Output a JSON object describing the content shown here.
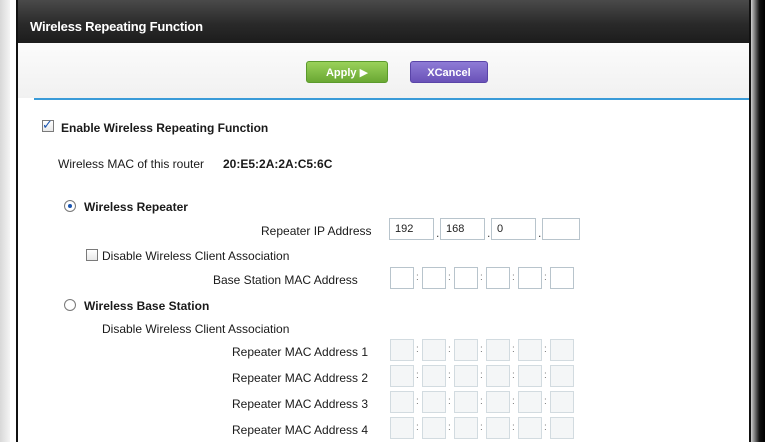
{
  "header": {
    "title": "Wireless Repeating Function"
  },
  "toolbar": {
    "apply_label": "Apply ▶",
    "cancel_label": "XCancel"
  },
  "enable": {
    "label": "Enable Wireless Repeating Function",
    "checked": true
  },
  "router_mac": {
    "label": "Wireless MAC of this router",
    "value": "20:E5:2A:2A:C5:6C"
  },
  "repeater": {
    "label": "Wireless Repeater",
    "selected": true,
    "ip_label": "Repeater IP Address",
    "ip": [
      "192",
      "168",
      "0",
      ""
    ],
    "disable_assoc_label": "Disable Wireless Client Association",
    "base_mac_label": "Base Station MAC Address"
  },
  "base_station": {
    "label": "Wireless Base Station",
    "selected": false,
    "disable_assoc_label": "Disable Wireless Client Association",
    "mac_labels": [
      "Repeater MAC Address 1",
      "Repeater MAC Address 2",
      "Repeater MAC Address 3",
      "Repeater MAC Address 4"
    ]
  },
  "colors": {
    "apply": "#7ab845",
    "cancel": "#7b63c8",
    "accent_rule": "#3a9bd8",
    "titlebar": "#2a2a2a"
  }
}
